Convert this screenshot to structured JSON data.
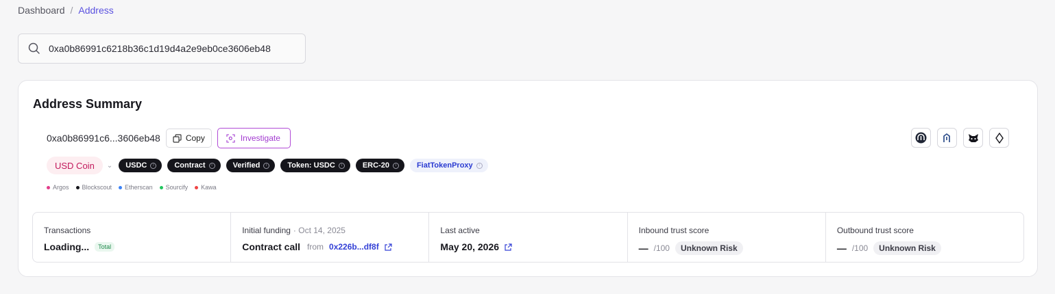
{
  "breadcrumb": {
    "root": "Dashboard",
    "separator": "/",
    "current": "Address"
  },
  "search": {
    "value": "0xa0b86991c6218b36c1d19d4a2e9eb0ce3606eb48",
    "icon": "search-icon"
  },
  "summary": {
    "title": "Address Summary",
    "address_short": "0xa0b86991c6...3606eb48",
    "copy_label": "Copy",
    "investigate_label": "Investigate",
    "name_label": "USD Coin",
    "tags": [
      {
        "label": "USDC",
        "style": "dark"
      },
      {
        "label": "Contract",
        "style": "dark"
      },
      {
        "label": "Verified",
        "style": "dark"
      },
      {
        "label": "Token: USDC",
        "style": "dark"
      },
      {
        "label": "ERC-20",
        "style": "dark"
      },
      {
        "label": "FiatTokenProxy",
        "style": "light"
      }
    ],
    "sources": [
      {
        "label": "Argos",
        "color": "#e23d8a"
      },
      {
        "label": "Blockscout",
        "color": "#15151b"
      },
      {
        "label": "Etherscan",
        "color": "#3b82f6"
      },
      {
        "label": "Sourcify",
        "color": "#22c55e"
      },
      {
        "label": "Kawa",
        "color": "#ef4444"
      }
    ],
    "external_icons": [
      "arkham-icon",
      "dune-icon",
      "metamask-icon",
      "ethereum-icon"
    ]
  },
  "stats": {
    "transactions": {
      "label": "Transactions",
      "value": "Loading...",
      "badge": "Total"
    },
    "funding": {
      "label": "Initial funding",
      "date": "· Oct 14, 2025",
      "value": "Contract call",
      "from_label": "from",
      "from_address": "0x226b...df8f"
    },
    "last_active": {
      "label": "Last active",
      "value": "May 20, 2026"
    },
    "inbound": {
      "label": "Inbound trust score",
      "score": "—",
      "max": "/100",
      "risk": "Unknown Risk"
    },
    "outbound": {
      "label": "Outbound trust score",
      "score": "—",
      "max": "/100",
      "risk": "Unknown Risk"
    }
  }
}
